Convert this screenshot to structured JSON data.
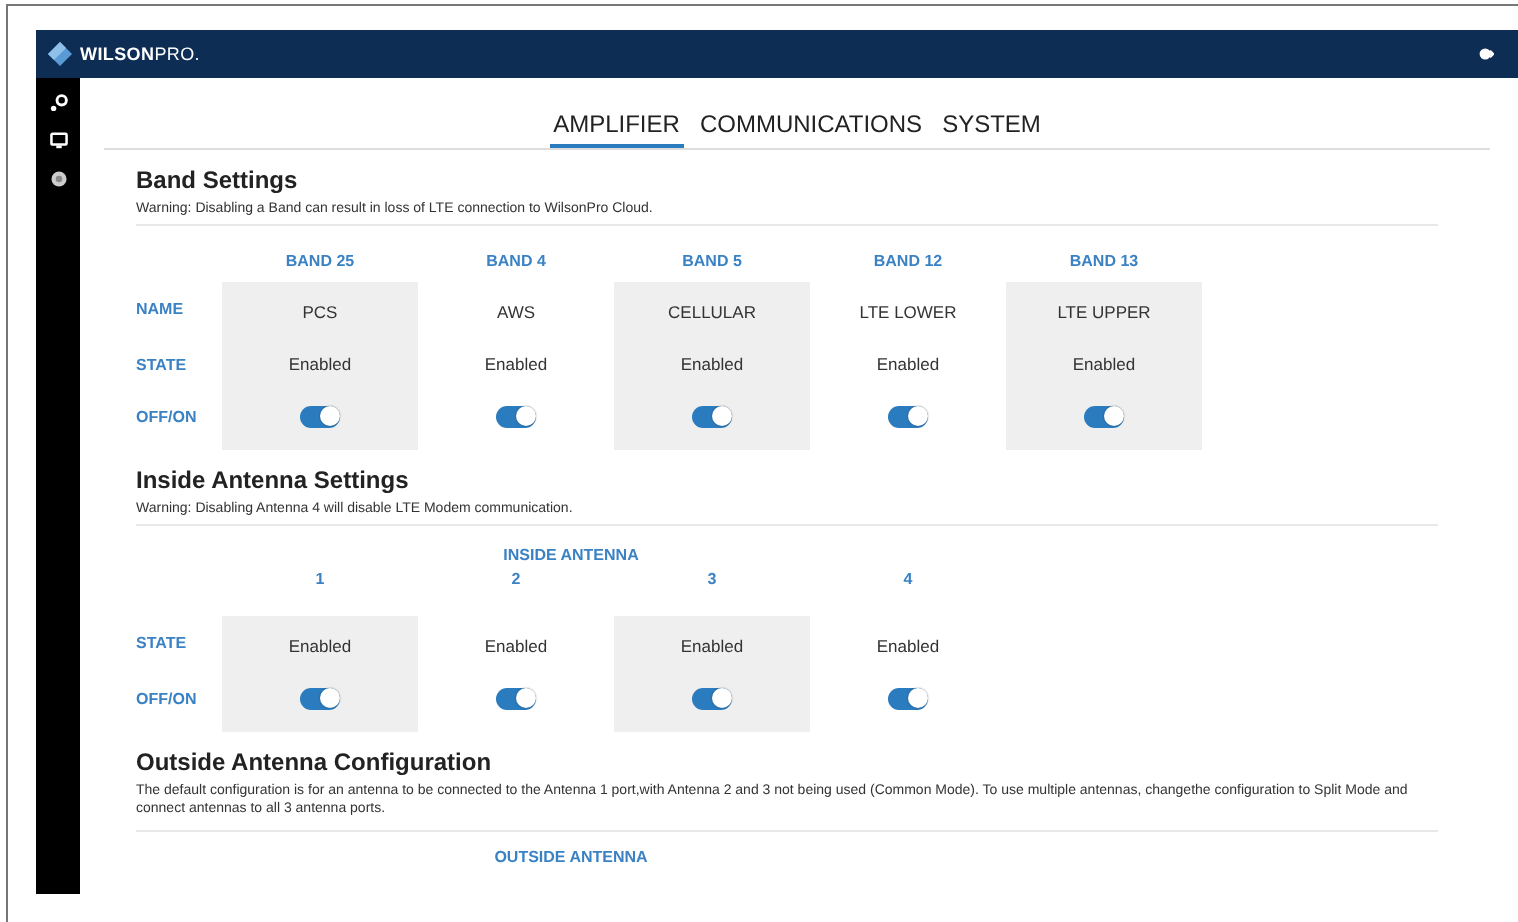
{
  "header": {
    "brand_bold": "WILSON",
    "brand_light": "PRO."
  },
  "tabs": [
    {
      "label": "AMPLIFIER",
      "selected": true
    },
    {
      "label": "COMMUNICATIONS",
      "selected": false
    },
    {
      "label": "SYSTEM",
      "selected": false
    }
  ],
  "band_settings": {
    "title": "Band Settings",
    "warning": "Warning: Disabling a Band can result in loss of LTE connection to WilsonPro Cloud.",
    "row_labels": [
      "NAME",
      "STATE",
      "OFF/ON"
    ],
    "bands": [
      {
        "band": "BAND 25",
        "name": "PCS",
        "state": "Enabled",
        "on": true
      },
      {
        "band": "BAND 4",
        "name": "AWS",
        "state": "Enabled",
        "on": true
      },
      {
        "band": "BAND 5",
        "name": "CELLULAR",
        "state": "Enabled",
        "on": true
      },
      {
        "band": "BAND 12",
        "name": "LTE LOWER",
        "state": "Enabled",
        "on": true
      },
      {
        "band": "BAND 13",
        "name": "LTE UPPER",
        "state": "Enabled",
        "on": true
      }
    ]
  },
  "inside_antenna": {
    "title": "Inside Antenna Settings",
    "warning": "Warning: Disabling Antenna 4 will disable LTE Modem communication.",
    "group_heading": "INSIDE ANTENNA",
    "row_labels": [
      "STATE",
      "OFF/ON"
    ],
    "antennas": [
      {
        "number": "1",
        "state": "Enabled",
        "on": true
      },
      {
        "number": "2",
        "state": "Enabled",
        "on": true
      },
      {
        "number": "3",
        "state": "Enabled",
        "on": true
      },
      {
        "number": "4",
        "state": "Enabled",
        "on": true
      }
    ]
  },
  "outside_antenna": {
    "title": "Outside Antenna Configuration",
    "description": "The default configuration is for an antenna to be connected to the Antenna 1 port,with Antenna 2 and 3 not being used (Common Mode). To use multiple antennas, changethe configuration to Split Mode and connect antennas to all 3 antenna ports.",
    "group_heading": "OUTSIDE ANTENNA"
  }
}
